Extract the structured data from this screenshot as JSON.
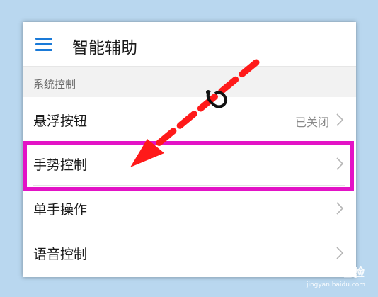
{
  "header": {
    "title": "智能辅助",
    "menu_icon": "hamburger-menu-icon"
  },
  "section": {
    "label": "系统控制"
  },
  "rows": [
    {
      "label": "悬浮按钮",
      "value": "已关闭"
    },
    {
      "label": "手势控制",
      "value": ""
    },
    {
      "label": "单手操作",
      "value": ""
    },
    {
      "label": "语音控制",
      "value": ""
    }
  ],
  "colors": {
    "background": "#b9d7ef",
    "accent": "#1a7ad8",
    "highlight": "#e313c6",
    "arrow": "#ff1a1a"
  },
  "watermark": {
    "brand": "Baidu经验",
    "sub": "jingyan.baidu.com"
  }
}
